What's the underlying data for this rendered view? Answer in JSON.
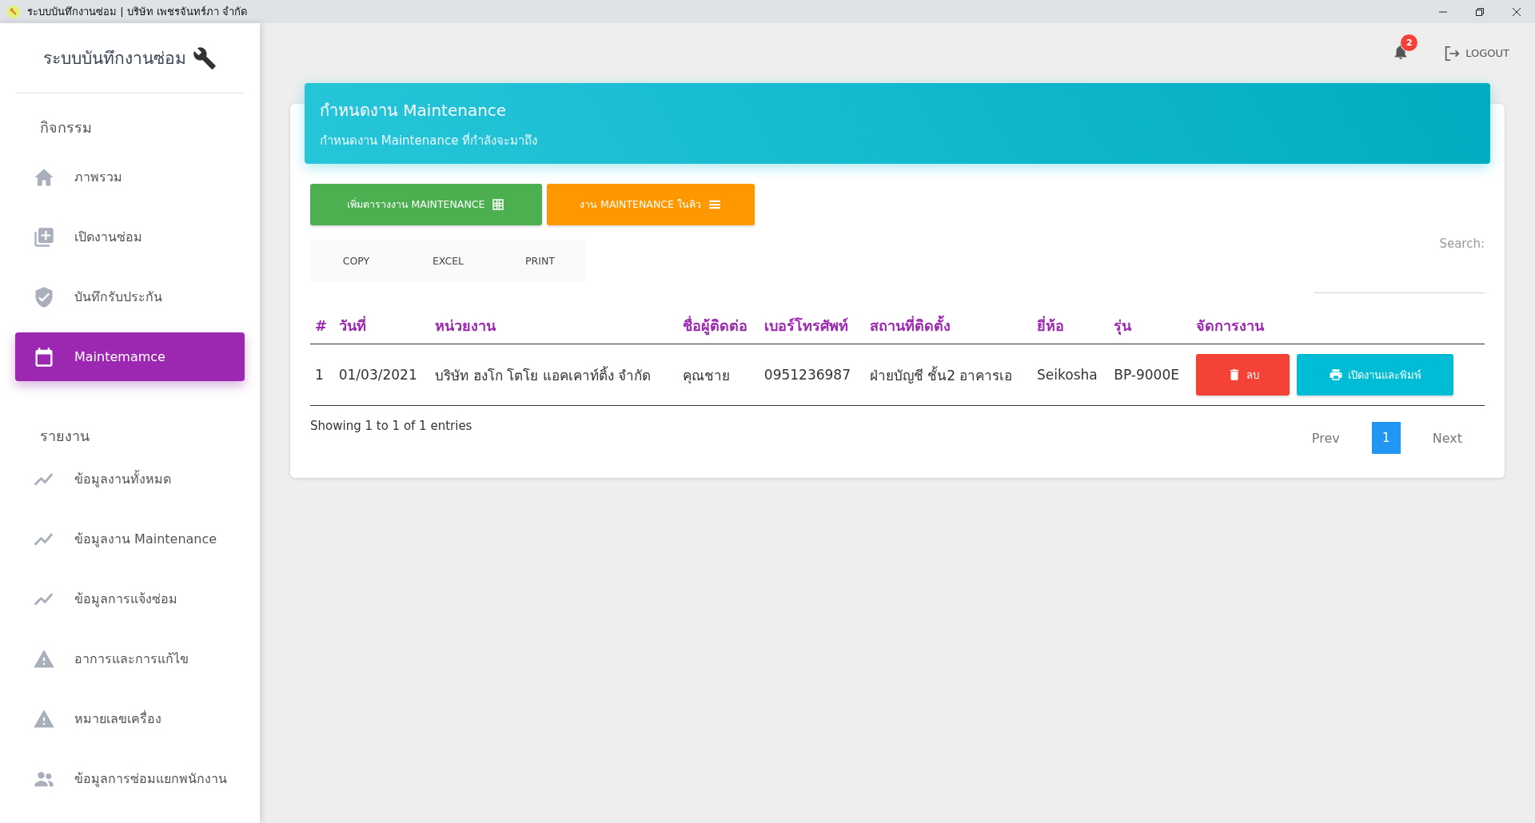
{
  "window": {
    "title": "ระบบบันทึกงานซ่อม | บริษัท เพชรจันทร์ภา จำกัด"
  },
  "sidebar": {
    "brand": "ระบบบันทึกงานซ่อม",
    "sections": [
      {
        "heading": "กิจกรรม",
        "items": [
          {
            "label": "ภาพรวม",
            "kind": "home",
            "selected": false
          },
          {
            "label": "เปิดงานซ่อม",
            "kind": "add",
            "selected": false
          },
          {
            "label": "บันทึกรับประกัน",
            "kind": "shield",
            "selected": false
          },
          {
            "label": "Maintemamce",
            "kind": "calendar",
            "selected": true
          }
        ]
      },
      {
        "heading": "รายงาน",
        "items": [
          {
            "label": "ข้อมูลงานทั้งหมด",
            "kind": "trend",
            "selected": false
          },
          {
            "label": "ข้อมูลงาน Maintenance",
            "kind": "trend",
            "selected": false
          },
          {
            "label": "ข้อมูลการแจ้งซ่อม",
            "kind": "trend",
            "selected": false
          },
          {
            "label": "อาการและการแก้ไข",
            "kind": "warning",
            "selected": false
          },
          {
            "label": "หมายเลขเครื่อง",
            "kind": "warning",
            "selected": false
          },
          {
            "label": "ข้อมูลการซ่อมแยกพนักงาน",
            "kind": "people",
            "selected": false
          }
        ]
      }
    ]
  },
  "topbar": {
    "notification_count": "2",
    "logout": "LOGOUT"
  },
  "card": {
    "title": "กำหนดงาน Maintenance",
    "subtitle": "กำหนดงาน Maintenance ที่กำลังจะมาถึง",
    "action_buttons": [
      {
        "label": "เพิ่มตารางงาน MAINTENANCE",
        "kind": "add"
      },
      {
        "label": "งาน MAINTENANCE ในคิว",
        "kind": "queue"
      }
    ],
    "export_buttons": [
      "COPY",
      "EXCEL",
      "PRINT"
    ],
    "search_label": "Search:",
    "table": {
      "columns": [
        "#",
        "วันที่",
        "หน่วยงาน",
        "ชื่อผู้ติดต่อ",
        "เบอร์โทรศัพท์",
        "สถานที่ติดตั้ง",
        "ยี่ห้อ",
        "รุ่น",
        "จัดการงาน"
      ],
      "rows": [
        {
          "cells": [
            "1",
            "01/03/2021",
            "บริษัท ฮงโก โตโย แอคเคาท์ติ้ง จำกัด",
            "คุณชาย",
            "0951236987",
            "ฝ่ายบัญชี ชั้น2 อาคารเอ",
            "Seikosha",
            "BP-9000E"
          ],
          "actions": [
            {
              "label": "ลบ",
              "kind": "delete"
            },
            {
              "label": "เปิดงานและพิมพ์",
              "kind": "print"
            }
          ]
        }
      ]
    },
    "info": "Showing 1 to 1 of 1 entries",
    "pagination": {
      "prev": "Prev",
      "pages": [
        {
          "label": "1",
          "selected": true
        }
      ],
      "next": "Next"
    }
  }
}
